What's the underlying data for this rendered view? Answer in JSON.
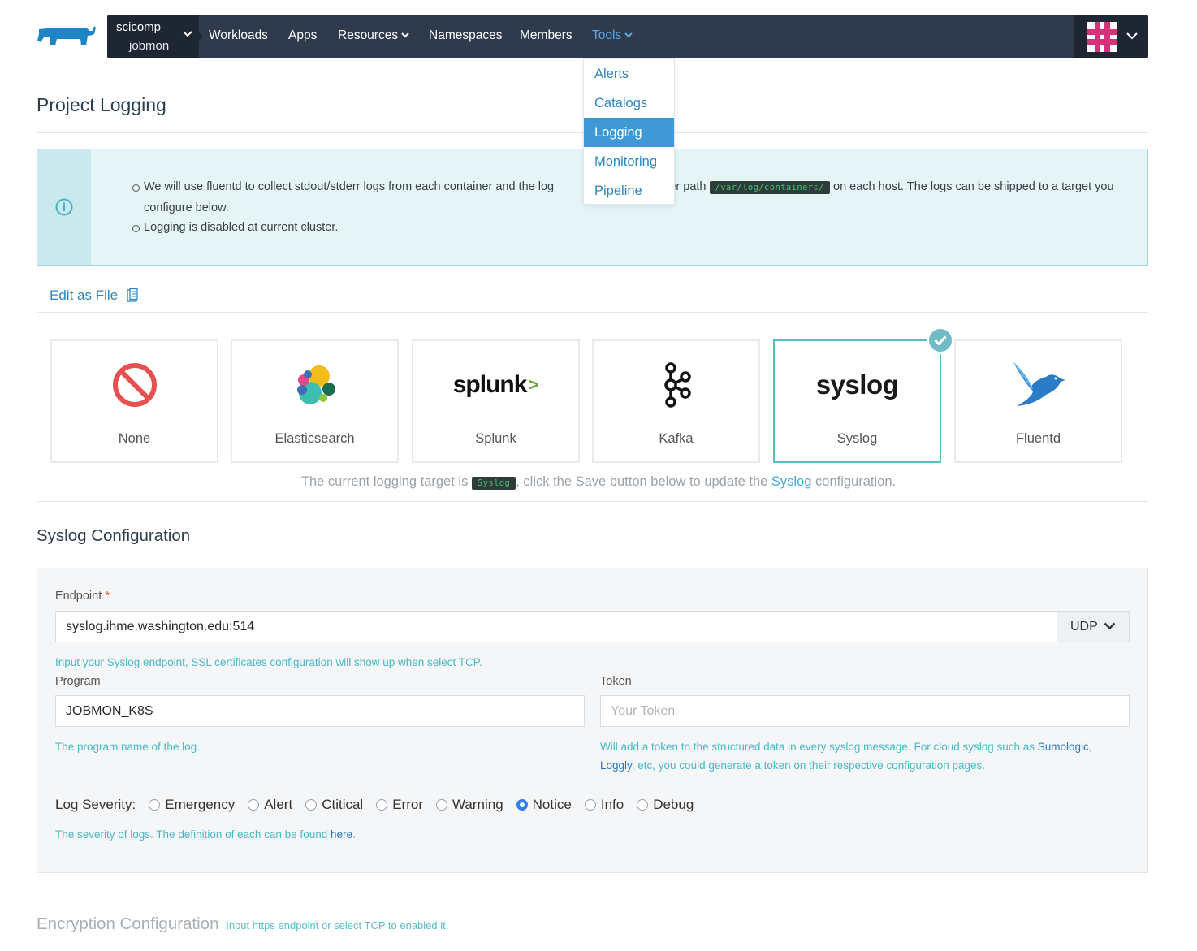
{
  "nav": {
    "cluster": "scicomp",
    "project": "jobmon",
    "items": [
      {
        "label": "Workloads",
        "has_caret": false
      },
      {
        "label": "Apps",
        "has_caret": false
      },
      {
        "label": "Resources",
        "has_caret": true
      },
      {
        "label": "Namespaces",
        "has_caret": false
      },
      {
        "label": "Members",
        "has_caret": false
      },
      {
        "label": "Tools",
        "has_caret": true,
        "active": true
      }
    ]
  },
  "tools_menu": {
    "items": [
      "Alerts",
      "Catalogs",
      "Logging",
      "Monitoring",
      "Pipeline"
    ],
    "selected": "Logging"
  },
  "page": {
    "title": "Project Logging"
  },
  "info": {
    "line1_before": "We will use fluentd to collect stdout/stderr logs from each container and the log",
    "line1_after": "t under path",
    "path": "/var/log/containers/",
    "line1_end": "on each host. The logs can be shipped to a target you configure below.",
    "line2": "Logging is disabled at current cluster."
  },
  "edit_as_file": "Edit as File",
  "targets": {
    "items": [
      "None",
      "Elasticsearch",
      "Splunk",
      "Kafka",
      "Syslog",
      "Fluentd"
    ],
    "selected": "Syslog",
    "splunk_logo_text": "splunk",
    "syslog_logo_text": "syslog"
  },
  "current_target": {
    "before": "The current logging target is",
    "target": "Syslog",
    "middle": ", click the Save button below to update the",
    "link": "Syslog",
    "after": "configuration."
  },
  "syslog_config": {
    "title": "Syslog Configuration",
    "endpoint_label": "Endpoint",
    "endpoint_value": "syslog.ihme.washington.edu:514",
    "protocol": "UDP",
    "endpoint_help": "Input your Syslog endpoint, SSL certificates configuration will show up when select TCP.",
    "program_label": "Program",
    "program_value": "JOBMON_K8S",
    "program_help": "The program name of the log.",
    "token_label": "Token",
    "token_placeholder": "Your Token",
    "token_help_before": "Will add a token to the structured data in every syslog message. For cloud syslog such as",
    "token_help_link1": "Sumologic",
    "token_help_link2": "Loggly",
    "token_help_after": ", etc, you could generate a token on their respective configuration pages.",
    "severity_label": "Log Severity:",
    "severities": [
      "Emergency",
      "Alert",
      "Ctitical",
      "Error",
      "Warning",
      "Notice",
      "Info",
      "Debug"
    ],
    "severity_selected": "Notice",
    "severity_help": "The severity of logs. The definition of each can be found",
    "severity_help_link": "here"
  },
  "encryption": {
    "title": "Encryption Configuration",
    "note": "Input https endpoint or select TCP to enabled it."
  },
  "colors": {
    "nav_bg": "#2f3b4c",
    "nav_dark": "#1e2633",
    "accent": "#3d98d3",
    "link": "#2e86c1",
    "banner_bg": "#e5f5f6",
    "help_text": "#4ab8c6",
    "selected_border": "#5bbcc3"
  }
}
